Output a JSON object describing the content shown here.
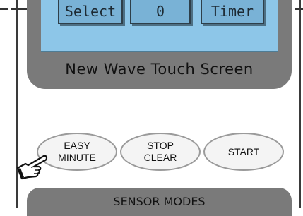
{
  "display": {
    "buttons": [
      "Select",
      "0",
      "Timer"
    ],
    "brand": "New Wave Touch Screen"
  },
  "keypad": {
    "easy_minute": {
      "line1": "EASY",
      "line2": "MINUTE"
    },
    "stop_clear": {
      "line1": "STOP",
      "line2": "CLEAR"
    },
    "start": "START"
  },
  "sensor_modes": "SENSOR MODES",
  "icons": {
    "pointer": "pointing-hand-icon"
  },
  "colors": {
    "panel": "#7a7a7a",
    "lcd": "#8dc6e8",
    "key_border": "#9a9a9a"
  }
}
